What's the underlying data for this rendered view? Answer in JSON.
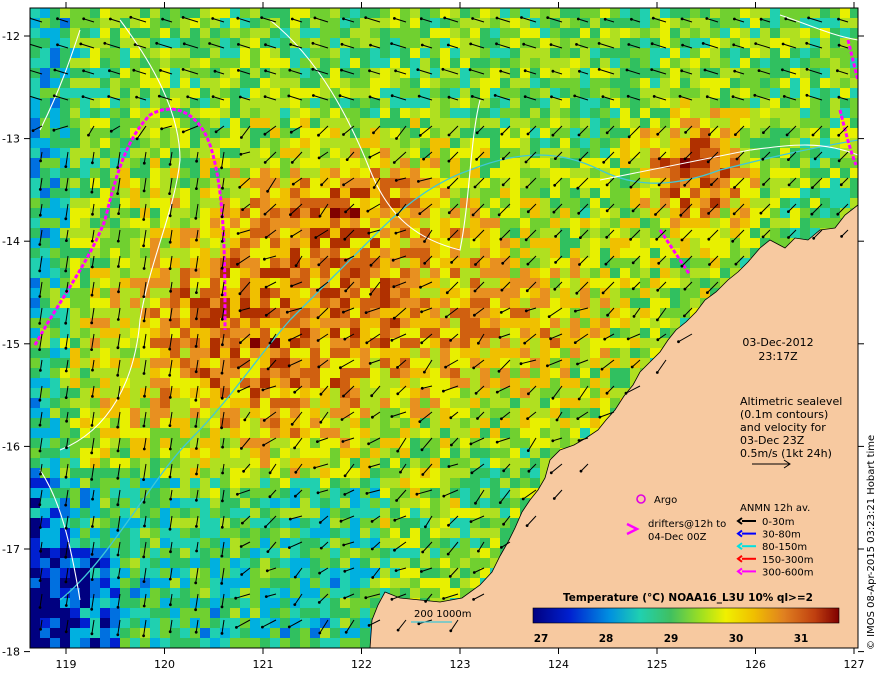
{
  "map": {
    "lon_ticks": [
      "119",
      "120",
      "121",
      "122",
      "123",
      "124",
      "125",
      "126",
      "127"
    ],
    "lat_ticks": [
      "-12",
      "-13",
      "-14",
      "-15",
      "-16",
      "-17",
      "-18"
    ],
    "datetime": {
      "date": "03-Dec-2012",
      "time": "23:17Z"
    },
    "altimetry_note": [
      "Altimetric sealevel",
      "(0.1m contours)",
      "and velocity for",
      "03-Dec 23Z",
      "0.5m/s (1kt 24h)"
    ],
    "argo_label": "Argo",
    "drifter_label": [
      "drifters@12h to",
      "04-Dec 00Z"
    ],
    "anmn": {
      "title": "ANMN 12h av.",
      "items": [
        {
          "label": "0-30m",
          "color": "#000000"
        },
        {
          "label": "30-80m",
          "color": "#0000ff"
        },
        {
          "label": "80-150m",
          "color": "#00e0e0"
        },
        {
          "label": "150-300m",
          "color": "#ff0000"
        },
        {
          "label": "300-600m",
          "color": "#ff00ff"
        }
      ]
    },
    "colorbar": {
      "title": "Temperature (°C) NOAA16_L3U 10% ql>=2",
      "labels": [
        "27",
        "28",
        "29",
        "30",
        "31"
      ]
    },
    "isobath_label": "200  1000m",
    "credit": "© IMOS 08-Apr-2015 03:23:21 Hobart time",
    "colors": {
      "land": "#f7c9a0",
      "argo": "#e000e0",
      "drifter": "#ff00ff",
      "isobath": "#40c8d8",
      "contour": "#ffffff"
    }
  }
}
